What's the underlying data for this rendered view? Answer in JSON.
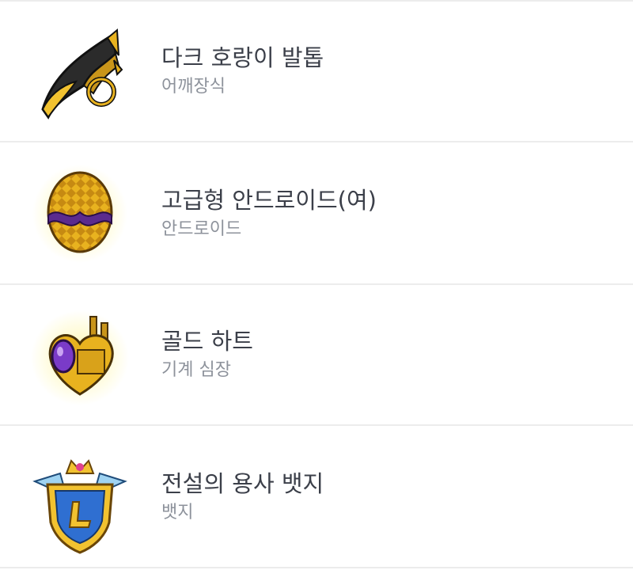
{
  "items": [
    {
      "name": "다크 호랑이 발톱",
      "type": "어깨장식",
      "icon": "dark-tiger-claw-icon"
    },
    {
      "name": "고급형 안드로이드(여)",
      "type": "안드로이드",
      "icon": "android-egg-icon"
    },
    {
      "name": "골드 하트",
      "type": "기계 심장",
      "icon": "gold-heart-icon"
    },
    {
      "name": "전설의 용사 뱃지",
      "type": "뱃지",
      "icon": "legend-badge-icon"
    }
  ],
  "colors": {
    "title": "#3b3f49",
    "subtitle": "#8d929b",
    "divider": "#ececec",
    "gold": "#e8b21f",
    "purple": "#5b2b8e",
    "blue": "#2f6fd1"
  }
}
